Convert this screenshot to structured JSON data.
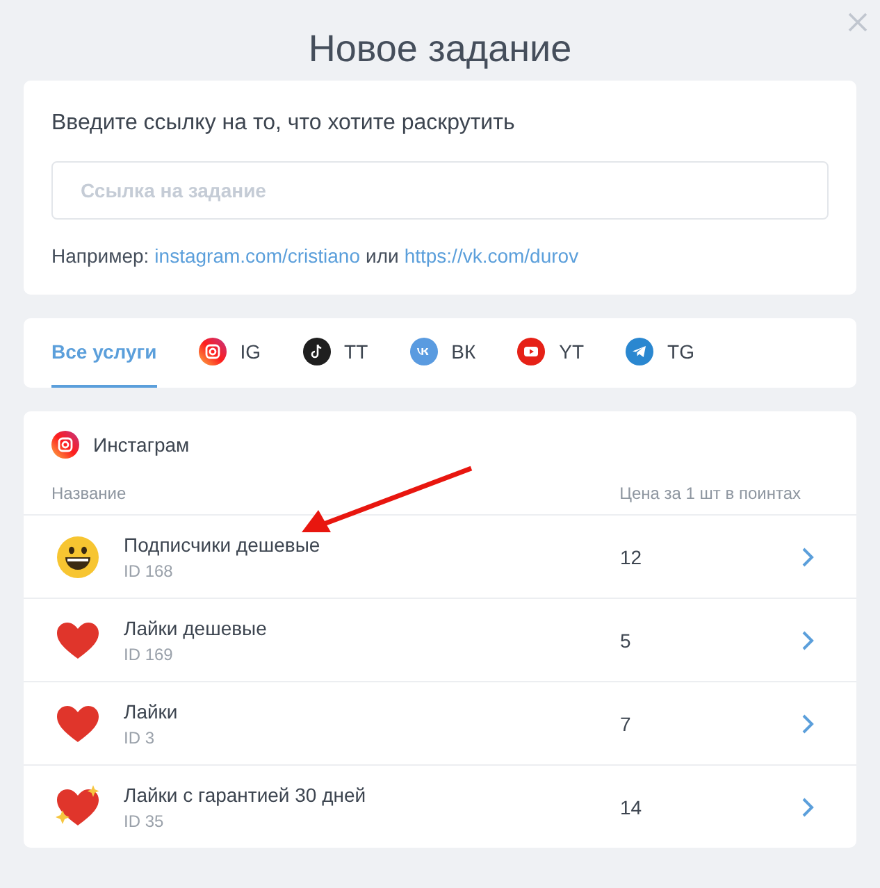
{
  "dialog": {
    "title": "Новое задание"
  },
  "link_card": {
    "label": "Введите ссылку на то, что хотите раскрутить",
    "placeholder": "Ссылка на задание",
    "hint_prefix": "Например:",
    "hint_link_1": "instagram.com/cristiano",
    "hint_middle": "или",
    "hint_link_2": "https://vk.com/durov"
  },
  "tabs": [
    {
      "label": "Все услуги",
      "kind": "all",
      "selected": true
    },
    {
      "label": "IG",
      "kind": "ig",
      "selected": false
    },
    {
      "label": "TT",
      "kind": "tt",
      "selected": false
    },
    {
      "label": "ВК",
      "kind": "vk",
      "selected": false
    },
    {
      "label": "YT",
      "kind": "yt",
      "selected": false
    },
    {
      "label": "TG",
      "kind": "tg",
      "selected": false
    }
  ],
  "services": {
    "section_title": "Инстаграм",
    "columns": [
      "Название",
      "Цена за 1 шт в поинтах"
    ],
    "rows": [
      {
        "name": "Подписчики дешевые",
        "id": "ID 168",
        "price": "12",
        "kind": "smiley"
      },
      {
        "name": "Лайки дешевые",
        "id": "ID 169",
        "price": "5",
        "kind": "heart"
      },
      {
        "name": "Лайки",
        "id": "ID 3",
        "price": "7",
        "kind": "heart"
      },
      {
        "name": "Лайки с гарантией 30 дней",
        "id": "ID 35",
        "price": "14",
        "kind": "sparkle-heart"
      }
    ]
  }
}
